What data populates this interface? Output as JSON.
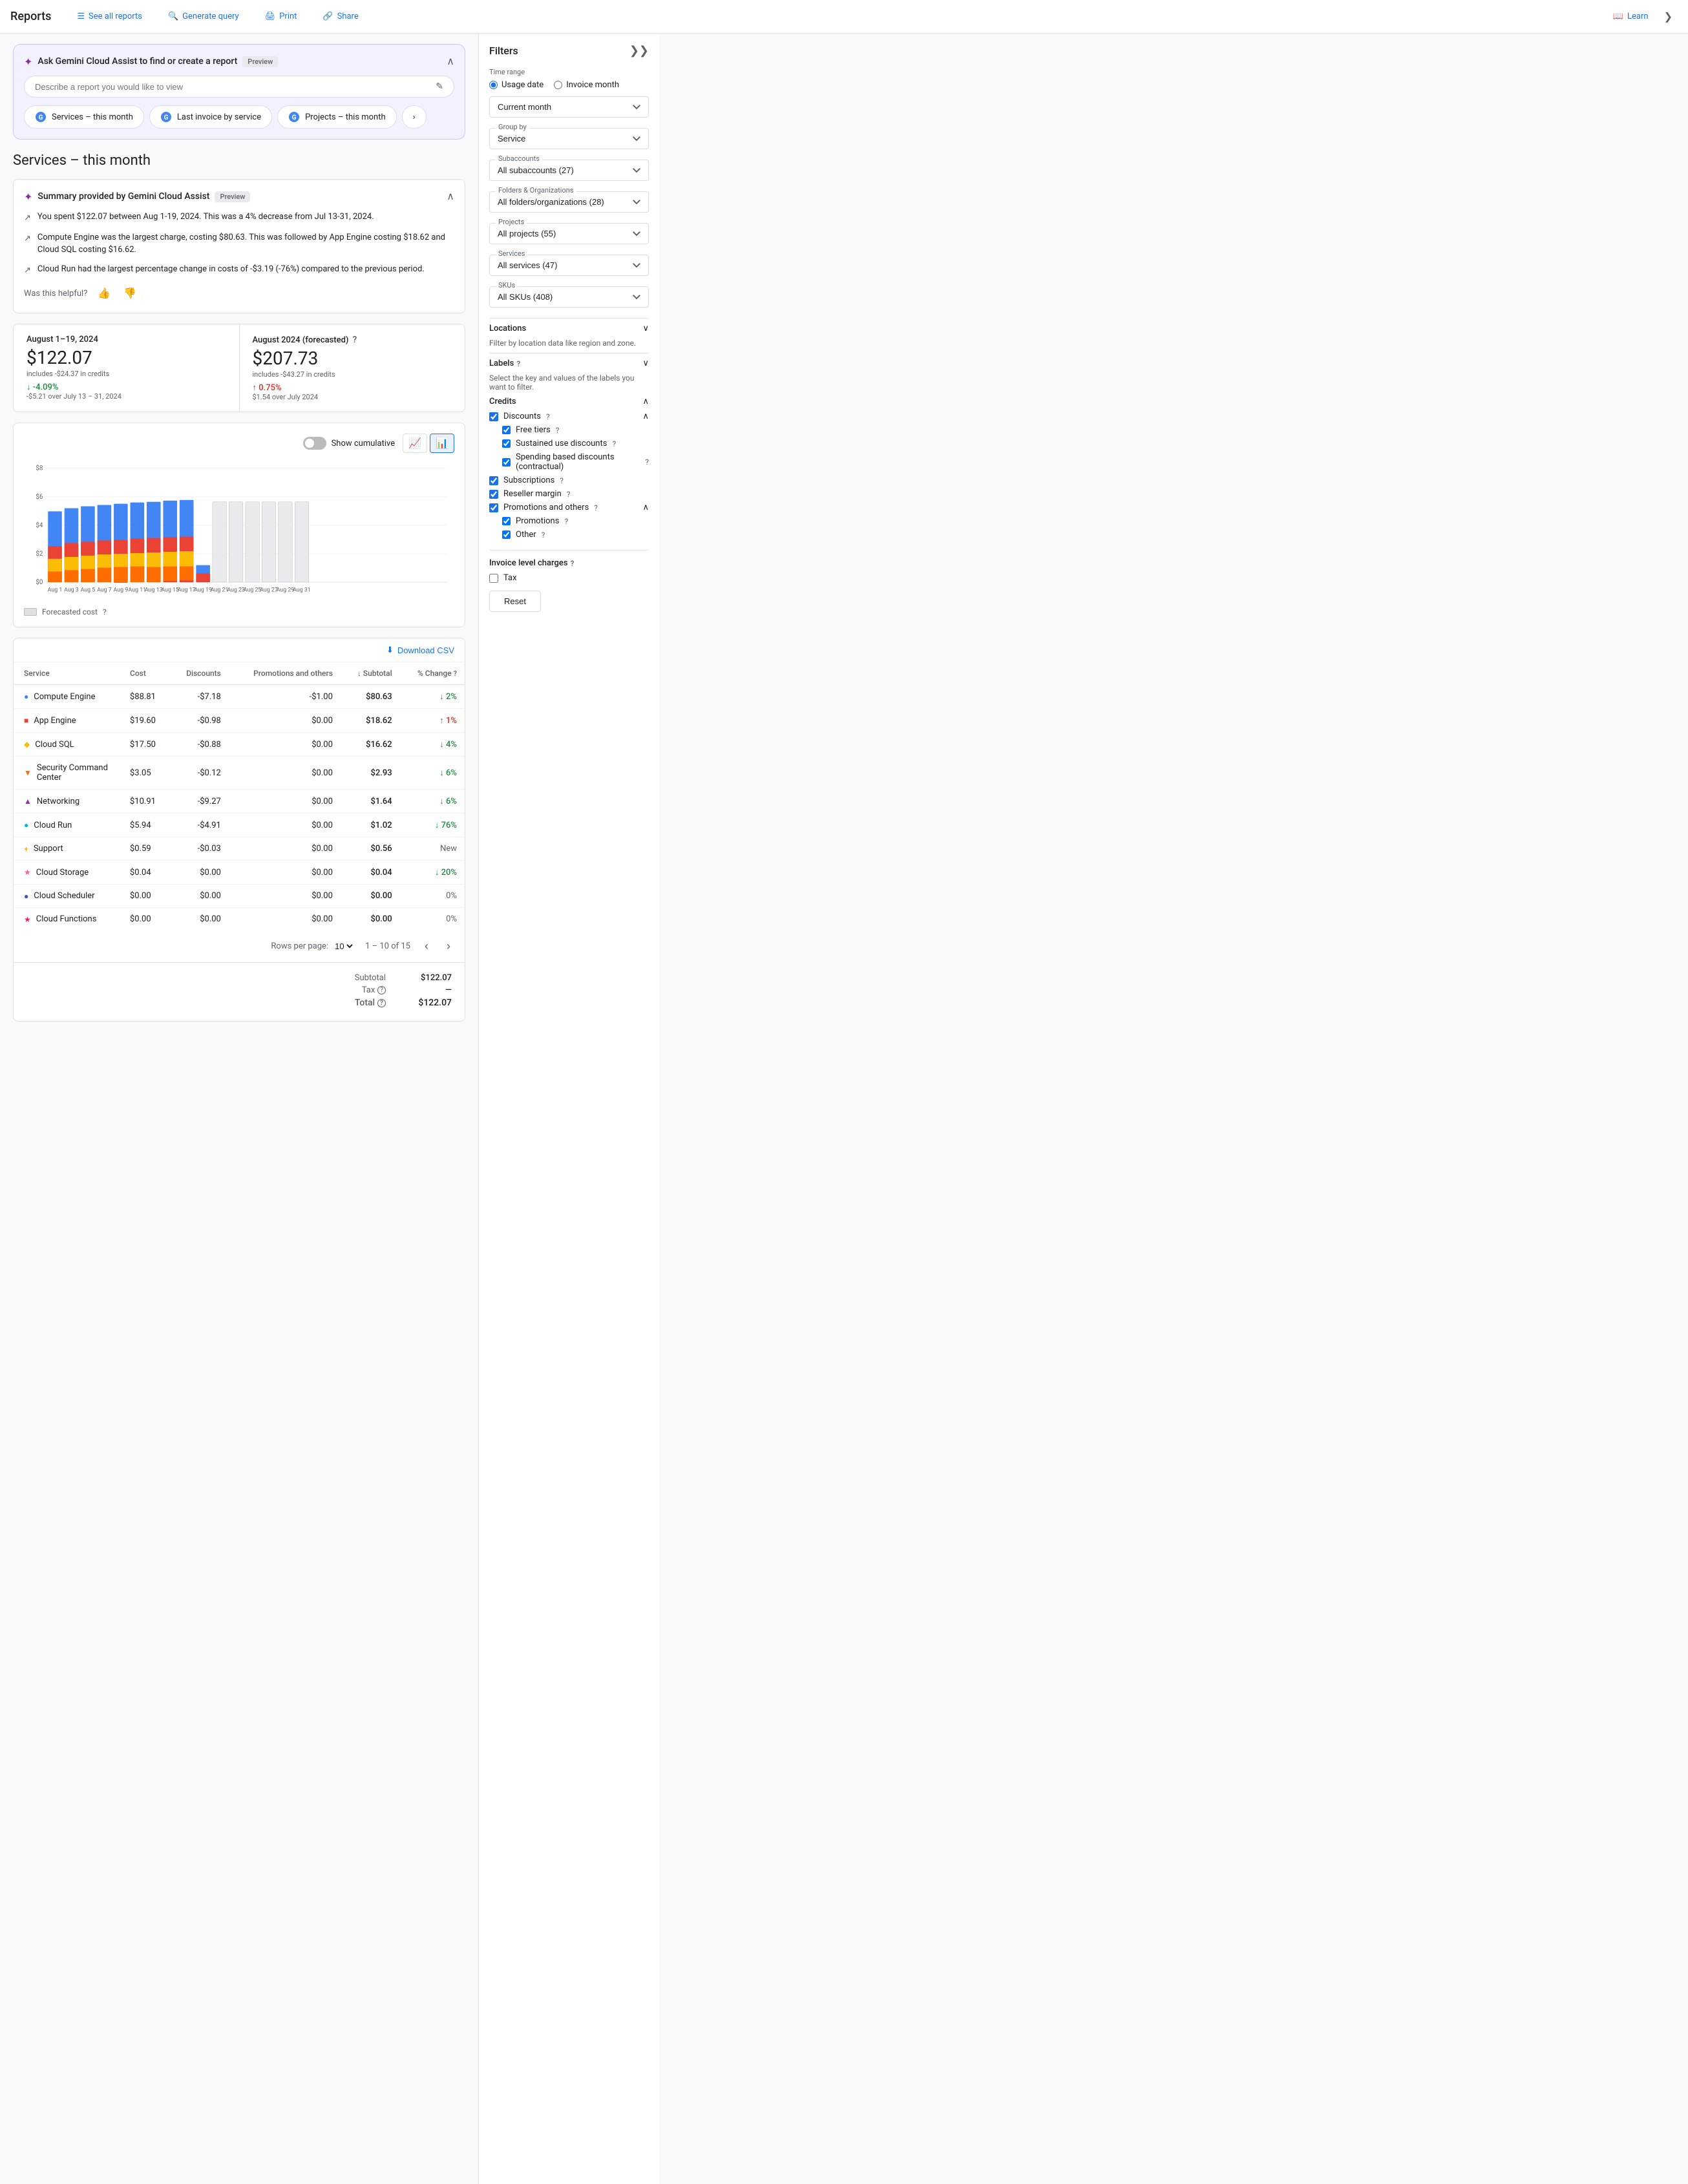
{
  "nav": {
    "title": "Reports",
    "links": [
      {
        "id": "see-all-reports",
        "label": "See all reports",
        "icon": "list-icon"
      },
      {
        "id": "generate-query",
        "label": "Generate query",
        "icon": "search-icon"
      },
      {
        "id": "print",
        "label": "Print",
        "icon": "print-icon"
      },
      {
        "id": "share",
        "label": "Share",
        "icon": "share-icon"
      }
    ],
    "learn_label": "Learn",
    "collapse_label": "❯"
  },
  "gemini": {
    "title": "Ask Gemini Cloud Assist to find or create a report",
    "preview_badge": "Preview",
    "input_placeholder": "Describe a report you would like to view",
    "chips": [
      {
        "id": "services-month",
        "label": "Services – this month"
      },
      {
        "id": "last-invoice",
        "label": "Last invoice by service"
      },
      {
        "id": "projects-month",
        "label": "Projects – this month"
      }
    ]
  },
  "page_title": "Services – this month",
  "summary": {
    "title": "Summary provided by Gemini Cloud Assist",
    "preview_badge": "Preview",
    "bullets": [
      "You spent $122.07 between Aug 1-19, 2024. This was a 4% decrease from Jul 13-31, 2024.",
      "Compute Engine was the largest charge, costing $80.63. This was followed by App Engine costing $18.62 and Cloud SQL costing $16.62.",
      "Cloud Run had the largest percentage change in costs of -$3.19 (-76%) compared to the previous period."
    ],
    "helpful_label": "Was this helpful?"
  },
  "stats": {
    "current": {
      "period": "August 1–19, 2024",
      "amount": "$122.07",
      "credits": "includes -$24.37 in credits",
      "change_pct": "↓ -4.09%",
      "change_type": "down",
      "change_sub": "-$5.21 over July 13 – 31, 2024"
    },
    "forecasted": {
      "period": "August 2024 (forecasted)",
      "amount": "$207.73",
      "credits": "includes -$43.27 in credits",
      "change_pct": "↑ 0.75%",
      "change_type": "up",
      "change_sub": "$1.54 over July 2024"
    }
  },
  "chart": {
    "show_cumulative_label": "Show cumulative",
    "y_labels": [
      "$8",
      "$6",
      "$4",
      "$2",
      "$0"
    ],
    "x_labels": [
      "Aug 1",
      "Aug 3",
      "Aug 5",
      "Aug 7",
      "Aug 9",
      "Aug 11",
      "Aug 13",
      "Aug 15",
      "Aug 17",
      "Aug 19",
      "Aug 21",
      "Aug 23",
      "Aug 25",
      "Aug 27",
      "Aug 29",
      "Aug 31"
    ],
    "forecasted_cost_label": "Forecasted cost",
    "download_csv_label": "Download CSV"
  },
  "table": {
    "columns": [
      "Service",
      "Cost",
      "Discounts",
      "Promotions and others",
      "Subtotal",
      "% Change"
    ],
    "rows": [
      {
        "service": "Compute Engine",
        "color": "#4285f4",
        "shape": "circle",
        "cost": "$88.81",
        "discounts": "-$7.18",
        "promotions": "-$1.00",
        "subtotal": "$80.63",
        "change": "↓ 2%",
        "change_type": "down"
      },
      {
        "service": "App Engine",
        "color": "#ea4335",
        "shape": "square",
        "cost": "$19.60",
        "discounts": "-$0.98",
        "promotions": "$0.00",
        "subtotal": "$18.62",
        "change": "↑ 1%",
        "change_type": "up"
      },
      {
        "service": "Cloud SQL",
        "color": "#fbbc04",
        "shape": "diamond",
        "cost": "$17.50",
        "discounts": "-$0.88",
        "promotions": "$0.00",
        "subtotal": "$16.62",
        "change": "↓ 4%",
        "change_type": "down"
      },
      {
        "service": "Security Command Center",
        "color": "#ff6d00",
        "shape": "triangle-down",
        "cost": "$3.05",
        "discounts": "-$0.12",
        "promotions": "$0.00",
        "subtotal": "$2.93",
        "change": "↓ 6%",
        "change_type": "down"
      },
      {
        "service": "Networking",
        "color": "#9c27b0",
        "shape": "triangle-up",
        "cost": "$10.91",
        "discounts": "-$9.27",
        "promotions": "$0.00",
        "subtotal": "$1.64",
        "change": "↓ 6%",
        "change_type": "down"
      },
      {
        "service": "Cloud Run",
        "color": "#00bcd4",
        "shape": "circle",
        "cost": "$5.94",
        "discounts": "-$4.91",
        "promotions": "$0.00",
        "subtotal": "$1.02",
        "change": "↓ 76%",
        "change_type": "down"
      },
      {
        "service": "Support",
        "color": "#ff9800",
        "shape": "plus",
        "cost": "$0.59",
        "discounts": "-$0.03",
        "promotions": "$0.00",
        "subtotal": "$0.56",
        "change": "New",
        "change_type": "neutral"
      },
      {
        "service": "Cloud Storage",
        "color": "#f06292",
        "shape": "star",
        "cost": "$0.04",
        "discounts": "$0.00",
        "promotions": "$0.00",
        "subtotal": "$0.04",
        "change": "↓ 20%",
        "change_type": "down"
      },
      {
        "service": "Cloud Scheduler",
        "color": "#3f51b5",
        "shape": "circle",
        "cost": "$0.00",
        "discounts": "$0.00",
        "promotions": "$0.00",
        "subtotal": "$0.00",
        "change": "0%",
        "change_type": "neutral"
      },
      {
        "service": "Cloud Functions",
        "color": "#e91e63",
        "shape": "star",
        "cost": "$0.00",
        "discounts": "$0.00",
        "promotions": "$0.00",
        "subtotal": "$0.00",
        "change": "0%",
        "change_type": "neutral"
      }
    ],
    "pagination": {
      "rows_per_page_label": "Rows per page:",
      "rows_per_page": "10",
      "page_info": "1 – 10 of 15"
    },
    "totals": {
      "subtotal_label": "Subtotal",
      "subtotal_value": "$122.07",
      "tax_label": "Tax",
      "tax_help": "?",
      "tax_value": "—",
      "total_label": "Total",
      "total_help": "?",
      "total_value": "$122.07"
    }
  },
  "filters": {
    "title": "Filters",
    "time_range_label": "Time range",
    "usage_date_label": "Usage date",
    "invoice_month_label": "Invoice month",
    "current_month_label": "Current month",
    "group_by_label": "Group by",
    "group_by_value": "Service",
    "subaccounts_label": "Subaccounts",
    "subaccounts_value": "All subaccounts (27)",
    "folders_label": "Folders & Organizations",
    "folders_value": "All folders/organizations (28)",
    "projects_label": "Projects",
    "projects_value": "All projects (55)",
    "services_label": "Services",
    "services_value": "All services (47)",
    "skus_label": "SKUs",
    "skus_value": "All SKUs (408)",
    "locations_label": "Locations",
    "locations_desc": "Filter by location data like region and zone.",
    "labels_label": "Labels",
    "labels_desc": "Select the key and values of the labels you want to filter.",
    "credits": {
      "title": "Credits",
      "discounts_label": "Discounts",
      "free_tiers_label": "Free tiers",
      "sustained_label": "Sustained use discounts",
      "spending_label": "Spending based discounts (contractual)",
      "subscriptions_label": "Subscriptions",
      "reseller_label": "Reseller margin",
      "promotions_label": "Promotions and others",
      "promotions_sub_label": "Promotions",
      "other_label": "Other"
    },
    "invoice_level_label": "Invoice level charges",
    "tax_label": "Tax",
    "reset_label": "Reset"
  }
}
